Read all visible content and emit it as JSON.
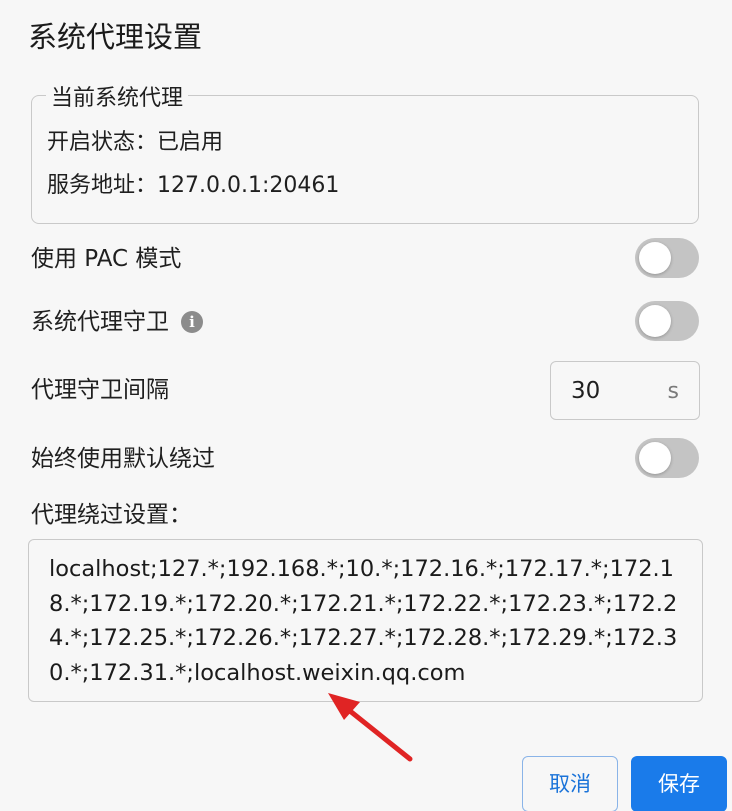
{
  "dialog": {
    "title": "系统代理设置"
  },
  "current_proxy": {
    "legend": "当前系统代理",
    "status_label": "开启状态：",
    "status_value": "已启用",
    "address_label": "服务地址：",
    "address_value": "127.0.0.1:20461"
  },
  "settings": {
    "pac_mode": {
      "label": "使用 PAC 模式",
      "enabled": false
    },
    "proxy_guard": {
      "label": "系统代理守卫",
      "enabled": false,
      "info_icon": "info-icon"
    },
    "guard_interval": {
      "label": "代理守卫间隔",
      "value": "30",
      "unit": "s"
    },
    "default_bypass": {
      "label": "始终使用默认绕过",
      "enabled": false
    }
  },
  "bypass": {
    "label": "代理绕过设置：",
    "value": "localhost;127.*;192.168.*;10.*;172.16.*;172.17.*;172.18.*;172.19.*;172.20.*;172.21.*;172.22.*;172.23.*;172.24.*;172.25.*;172.26.*;172.27.*;172.28.*;172.29.*;172.30.*;172.31.*;localhost.weixin.qq.com"
  },
  "buttons": {
    "cancel": "取消",
    "save": "保存"
  },
  "colors": {
    "accent": "#1a7bea",
    "toggle_off": "#c4c4c4",
    "annotation_arrow": "#e02424"
  }
}
